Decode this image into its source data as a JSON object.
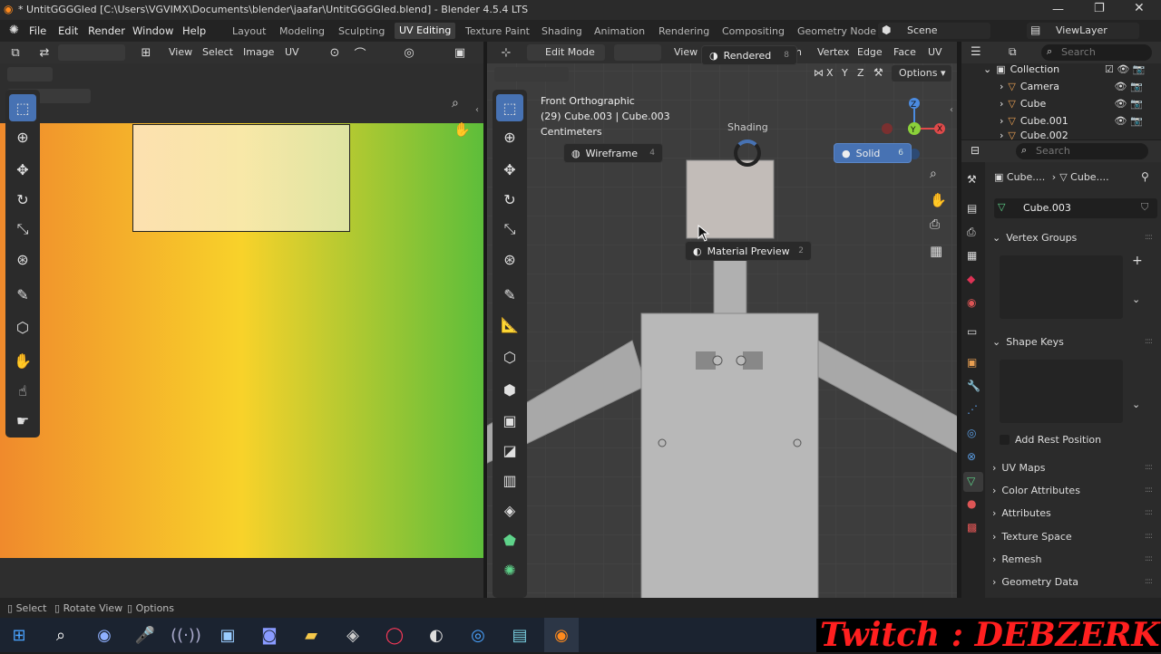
{
  "title_bar": {
    "title": "* UntitGGGGled [C:\\Users\\VGVIMX\\Documents\\blender\\jaafar\\UntitGGGGled.blend] - Blender 4.5.4 LTS"
  },
  "menu": {
    "items": [
      "File",
      "Edit",
      "Render",
      "Window",
      "Help"
    ]
  },
  "workspaces": [
    "Layout",
    "Modeling",
    "Sculpting",
    "UV Editing",
    "Texture Paint",
    "Shading",
    "Animation",
    "Rendering",
    "Compositing",
    "Geometry Node"
  ],
  "scene": {
    "label": "Scene",
    "view_layer": "ViewLayer"
  },
  "uv_editor": {
    "header": [
      "View",
      "Select",
      "Image",
      "UV"
    ]
  },
  "viewport": {
    "mode": "Edit Mode",
    "view_menu": "View",
    "edit_menus": [
      "h",
      "Vertex",
      "Edge",
      "Face",
      "UV"
    ],
    "options": "Options",
    "axes": [
      "X",
      "Y",
      "Z"
    ],
    "info_line1": "Front Orthographic",
    "info_line2": "(29) Cube.003 | Cube.003",
    "info_line3": "Centimeters",
    "pie_title": "Shading",
    "pie": {
      "rendered": "Rendered",
      "rendered_num": "8",
      "wireframe": "Wireframe",
      "wireframe_num": "4",
      "solid": "Solid",
      "solid_num": "6",
      "material": "Material Preview",
      "material_num": "2"
    }
  },
  "outliner": {
    "search_placeholder": "Search",
    "collection": "Collection",
    "items": [
      "Camera",
      "Cube",
      "Cube.001",
      "Cube.002"
    ]
  },
  "properties": {
    "search_placeholder": "Search",
    "breadcrumb_obj": "Cube....",
    "breadcrumb_mesh": "Cube....",
    "mesh_name": "Cube.003",
    "vertex_groups": "Vertex Groups",
    "shape_keys": "Shape Keys",
    "add_rest": "Add Rest Position",
    "sections": [
      "UV Maps",
      "Color Attributes",
      "Attributes",
      "Texture Space",
      "Remesh",
      "Geometry Data"
    ]
  },
  "status": {
    "select": "Select",
    "rotate": "Rotate View",
    "options": "Options"
  },
  "overlay": {
    "twitch": "Twitch : DEBZERK"
  },
  "colors": {
    "accent": "#4772b3",
    "uv_bg_start": "#f08a2c",
    "uv_bg_mid": "#f8d22a",
    "uv_bg_end": "#5dbe3a"
  }
}
